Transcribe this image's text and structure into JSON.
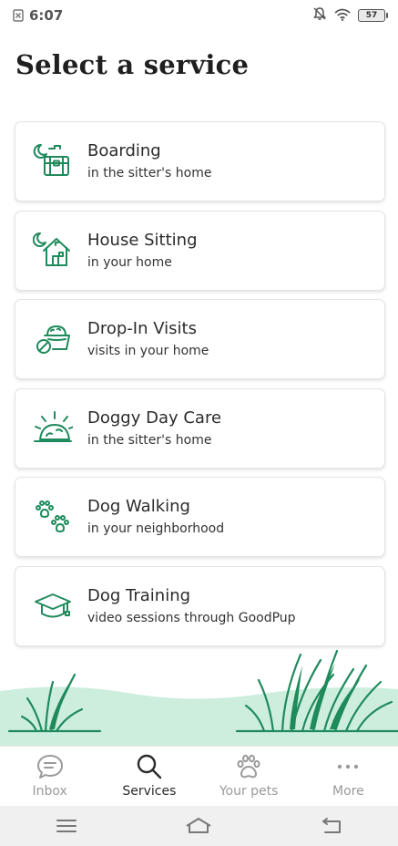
{
  "status_bar": {
    "time": "6:07",
    "battery": "57",
    "icons": [
      "notification-icon",
      "mute-icon",
      "wifi-icon",
      "battery-icon"
    ]
  },
  "page": {
    "title": "Select a service"
  },
  "services": [
    {
      "title": "Boarding",
      "subtitle": "in the sitter's home",
      "icon": "boarding-icon"
    },
    {
      "title": "House Sitting",
      "subtitle": "in your home",
      "icon": "house-sitting-icon"
    },
    {
      "title": "Drop-In Visits",
      "subtitle": "visits in your home",
      "icon": "drop-in-visits-icon"
    },
    {
      "title": "Doggy Day Care",
      "subtitle": "in the sitter's home",
      "icon": "day-care-icon"
    },
    {
      "title": "Dog Walking",
      "subtitle": "in your neighborhood",
      "icon": "dog-walking-icon"
    },
    {
      "title": "Dog Training",
      "subtitle": "video sessions through GoodPup",
      "icon": "dog-training-icon"
    }
  ],
  "bottom_nav": {
    "items": [
      {
        "label": "Inbox",
        "icon": "chat-bubble-icon",
        "active": false
      },
      {
        "label": "Services",
        "icon": "search-icon",
        "active": true
      },
      {
        "label": "Your pets",
        "icon": "paw-icon",
        "active": false
      },
      {
        "label": "More",
        "icon": "more-icon",
        "active": false
      }
    ]
  },
  "colors": {
    "accent_green": "#1f8a5c",
    "grass_light": "#cdeedd",
    "nav_inactive": "#9a9a9a",
    "nav_active": "#2b2b2b"
  }
}
